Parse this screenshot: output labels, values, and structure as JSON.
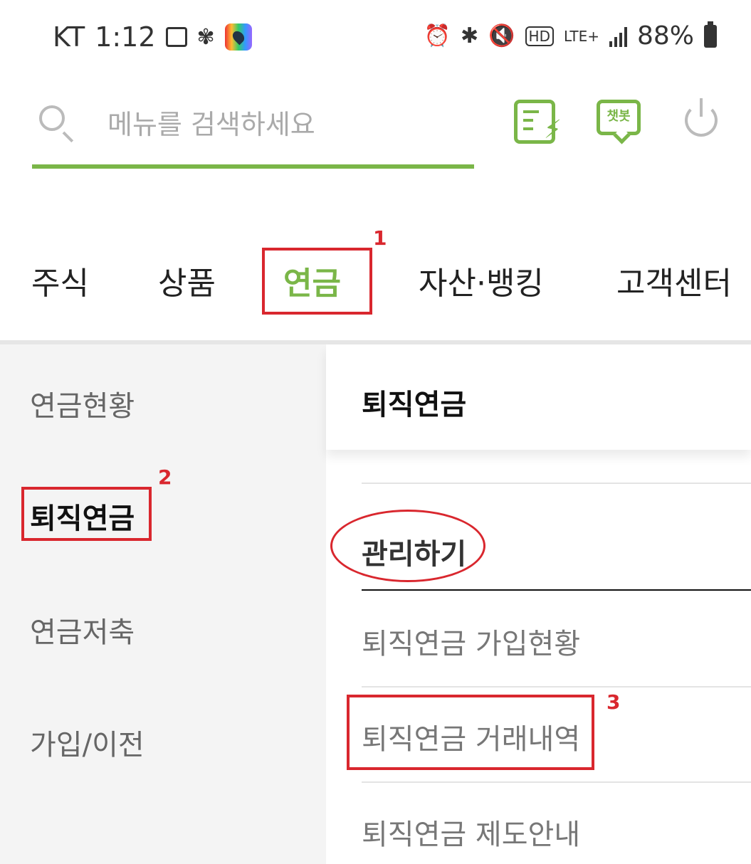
{
  "status_bar": {
    "carrier": "KT",
    "time": "1:12",
    "battery": "88%",
    "lte": "LTE+",
    "hd": "HD"
  },
  "search": {
    "placeholder": "메뉴를 검색하세요",
    "value": ""
  },
  "header_icons": {
    "quick": "document-bolt-icon",
    "chatbot_label": "챗봇",
    "power": "power-icon"
  },
  "tabs": [
    {
      "label": "주식"
    },
    {
      "label": "상품"
    },
    {
      "label": "연금"
    },
    {
      "label": "자산·뱅킹"
    },
    {
      "label": "고객센터"
    }
  ],
  "active_tab": "연금",
  "sidebar": {
    "items": [
      {
        "label": "연금현황"
      },
      {
        "label": "퇴직연금"
      },
      {
        "label": "연금저축"
      },
      {
        "label": "가입/이전"
      }
    ]
  },
  "panel": {
    "title": "퇴직연금",
    "section": "관리하기",
    "items": [
      {
        "label": "퇴직연금 가입현황"
      },
      {
        "label": "퇴직연금 거래내역"
      },
      {
        "label": "퇴직연금 제도안내"
      }
    ]
  },
  "annotations": {
    "n1": "1",
    "n2": "2",
    "n3": "3"
  },
  "colors": {
    "accent": "#7ab648",
    "annotation": "#d9272e"
  }
}
